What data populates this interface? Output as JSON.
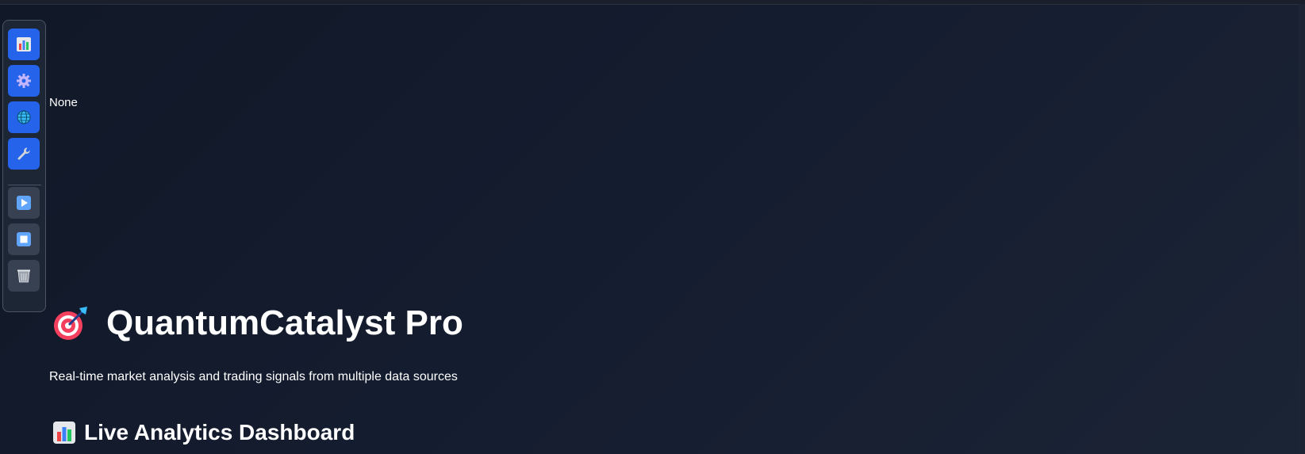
{
  "toolbar": {
    "buttons": [
      {
        "icon": "bar-chart-icon",
        "style": "primary"
      },
      {
        "icon": "gear-icon",
        "style": "primary"
      },
      {
        "icon": "globe-icon",
        "style": "primary"
      },
      {
        "icon": "wrench-icon",
        "style": "primary"
      },
      {
        "icon": "play-icon",
        "style": "secondary"
      },
      {
        "icon": "stop-icon",
        "style": "secondary"
      },
      {
        "icon": "trash-icon",
        "style": "secondary"
      }
    ]
  },
  "status_text": "None",
  "header": {
    "icon": "target-icon",
    "title": "QuantumCatalyst Pro",
    "subtitle": "Real-time market analysis and trading signals from multiple data sources"
  },
  "section": {
    "icon": "bar-chart-icon",
    "title": "Live Analytics Dashboard"
  },
  "colors": {
    "background": "#111827",
    "primary_button": "#2563eb",
    "secondary_button": "#374151",
    "text": "#ffffff"
  }
}
